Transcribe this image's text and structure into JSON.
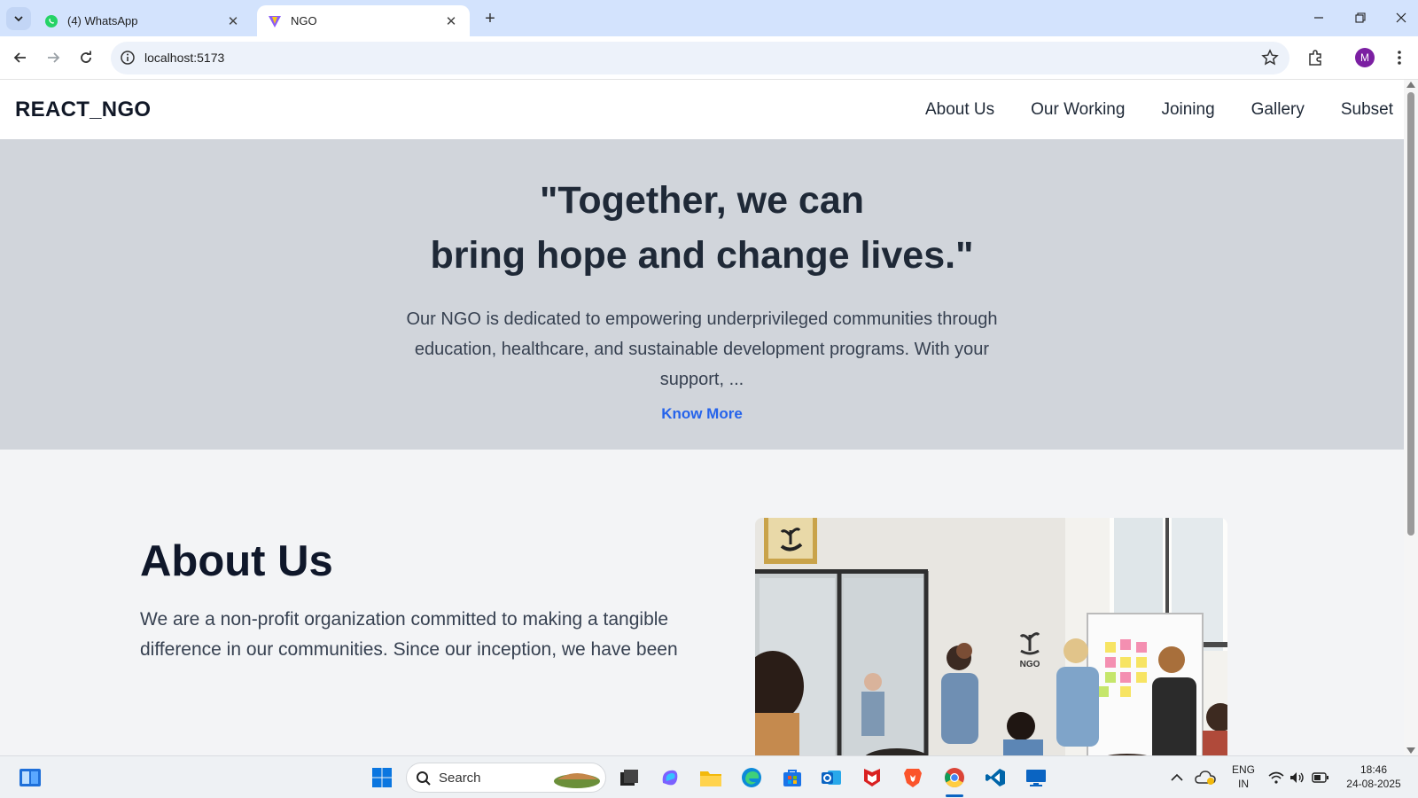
{
  "browser": {
    "tabs": [
      {
        "title": "(4) WhatsApp",
        "favicon": "whatsapp-icon",
        "active": false
      },
      {
        "title": "NGO",
        "favicon": "vite-icon",
        "active": true
      }
    ],
    "address": "localhost:5173",
    "profile_initial": "M"
  },
  "site": {
    "brand": "REACT_NGO",
    "nav": [
      "About Us",
      "Our Working",
      "Joining",
      "Gallery",
      "Subset"
    ],
    "hero": {
      "quote_line1": "\"Together, we can",
      "quote_line2": "bring hope and change lives.\"",
      "description": "Our NGO is dedicated to empowering underprivileged communities through education, healthcare, and sustainable development programs. With your support, ...",
      "cta": "Know More"
    },
    "about": {
      "title": "About Us",
      "text": "We are a non-profit organization committed to making a tangible difference in our communities. Since our inception, we have been"
    },
    "photo_sign_text": "NGO"
  },
  "taskbar": {
    "search_label": "Search",
    "language": "ENG",
    "region": "IN",
    "time": "18:46",
    "date": "24-08-2025"
  },
  "colors": {
    "hero_bg": "#d1d5db",
    "page_bg": "#f3f4f6",
    "link": "#2563eb",
    "brand_text": "#111827"
  }
}
